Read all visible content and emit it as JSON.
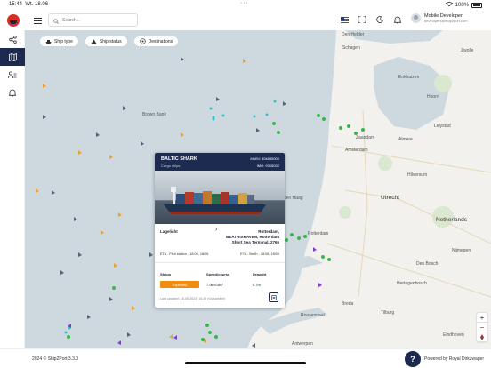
{
  "status_bar": {
    "time": "15:44",
    "date": "Wt. 18.06",
    "battery": "100%"
  },
  "topbar": {
    "search_placeholder": "Search...",
    "user_name": "Mobile Developer",
    "user_email": "developers@shipzport.com"
  },
  "sidebar": {
    "items": [
      "share-nodes-icon",
      "map-icon",
      "user-list-icon",
      "bell-icon"
    ]
  },
  "filters": [
    {
      "label": "Ship type",
      "icon": "ship-icon"
    },
    {
      "label": "Ship status",
      "icon": "warning-icon"
    },
    {
      "label": "Destinations",
      "icon": "target-icon"
    }
  ],
  "map": {
    "cities": [
      {
        "name": "Schagen"
      },
      {
        "name": "Hoorn"
      },
      {
        "name": "Amsterdam"
      },
      {
        "name": "Utrecht"
      },
      {
        "name": "Rotterdam"
      },
      {
        "name": "Breda"
      },
      {
        "name": "Tilburg"
      },
      {
        "name": "Den Haag"
      },
      {
        "name": "Lelystad"
      },
      {
        "name": "Netherlands"
      },
      {
        "name": "Antwerpen"
      },
      {
        "name": "Den Bosch"
      },
      {
        "name": "Eindhoven"
      },
      {
        "name": "Zwolle"
      },
      {
        "name": "Hilversum"
      },
      {
        "name": "Hertogenbosch"
      },
      {
        "name": "Nijmegen"
      },
      {
        "name": "Almere"
      },
      {
        "name": "Brown Bank"
      },
      {
        "name": "Roosendaal"
      },
      {
        "name": "Enkhuizen"
      },
      {
        "name": "Den Helder"
      },
      {
        "name": "Zaandam"
      }
    ]
  },
  "vessel_card": {
    "name": "BALTIC SHARK",
    "type": "Cargo ships",
    "mmsi": "MMSI: 304835000",
    "imo": "IMO: 9315032",
    "from_port": "Lagelicht",
    "to_port": "Rotterdam, BEATRIXHAVEN, Rotterdam Short Sea Terminal, 2765",
    "eta_from": "ETA - Pilot station - 18:06, 18/06",
    "eta_to": "ETA - Berth - 18:06, 18/06",
    "status_label": "Status",
    "status_value": "Expected",
    "speed_label": "Speed/course",
    "speed_value": "7.9kn/180°",
    "draught_label": "Draught",
    "draught_value": "6.7m",
    "last_updated": "Last updated: 18-06-2024, 15:39 (via satellite)"
  },
  "footer": {
    "copyright": "2024 © Ship2Port 3.3.0",
    "powered": "Powered by Royal Dirkzwager"
  },
  "colors": {
    "navy": "#1b2a4e",
    "accent_orange": "#f28c0f",
    "sea": "#cdd9df",
    "land": "#f2f1ee"
  }
}
